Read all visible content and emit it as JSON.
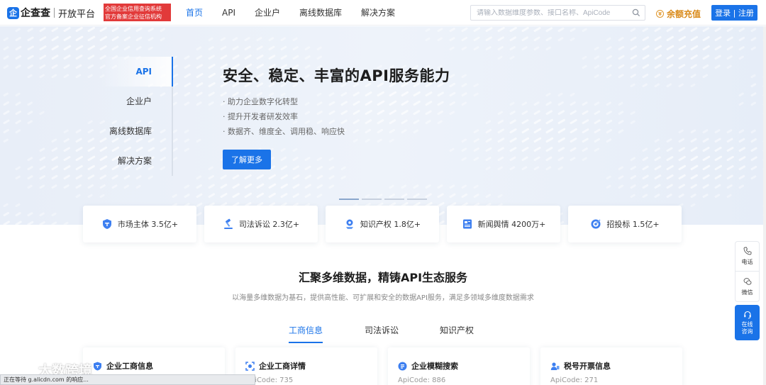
{
  "header": {
    "logo_mark": "企",
    "logo_text": "企查查",
    "logo_sub": "开放平台",
    "badge_line1": "全国企业信用查询系统",
    "badge_line2": "官方备案企业征信机构",
    "nav": [
      "首页",
      "API",
      "企业户",
      "离线数据库",
      "解决方案"
    ],
    "search_placeholder": "请输入数据维度参数、接口名称、ApiCode",
    "recharge": "余额充值",
    "recharge_icon": "¥",
    "login": "登录 | 注册"
  },
  "hero": {
    "side_tabs": [
      "API",
      "企业户",
      "离线数据库",
      "解决方案"
    ],
    "title": "安全、稳定、丰富的API服务能力",
    "bullets": [
      "· 助力企业数字化转型",
      "· 提升开发者研发效率",
      "· 数据齐、维度全、调用稳、响应快"
    ],
    "button": "了解更多",
    "slides_total": 4,
    "slide_active": 1
  },
  "stats": [
    {
      "icon": "market-entity-icon",
      "label": "市场主体 3.5亿+",
      "color": "#3d7ff0"
    },
    {
      "icon": "judicial-litigation-icon",
      "label": "司法诉讼 2.3亿+",
      "color": "#3d7ff0"
    },
    {
      "icon": "intellectual-property-icon",
      "label": "知识产权 1.8亿+",
      "color": "#3d7ff0"
    },
    {
      "icon": "news-sentiment-icon",
      "label": "新闻舆情 4200万+",
      "color": "#3d7ff0"
    },
    {
      "icon": "bidding-icon",
      "label": "招投标 1.5亿+",
      "color": "#3d7ff0"
    }
  ],
  "section": {
    "title": "汇聚多维数据，精铸API生态服务",
    "subtitle": "以海量多维数据为基石，提供高性能、可扩展和安全的数据API服务，满足多领域多维度数据需求",
    "tabs": [
      "工商信息",
      "司法诉讼",
      "知识产权"
    ]
  },
  "cards": [
    {
      "title": "企业工商信息",
      "code": ""
    },
    {
      "title": "企业工商详情",
      "code": "ApiCode: 735"
    },
    {
      "title": "企业模糊搜索",
      "code": "ApiCode: 886"
    },
    {
      "title": "税号开票信息",
      "code": "ApiCode: 271"
    }
  ],
  "float": {
    "phone": "电话",
    "wechat": "微信",
    "consult_line1": "在线",
    "consult_line2": "咨询"
  },
  "watermark": "大数跨境",
  "statusbar": "正在等待 g.alicdn.com 的响应..."
}
